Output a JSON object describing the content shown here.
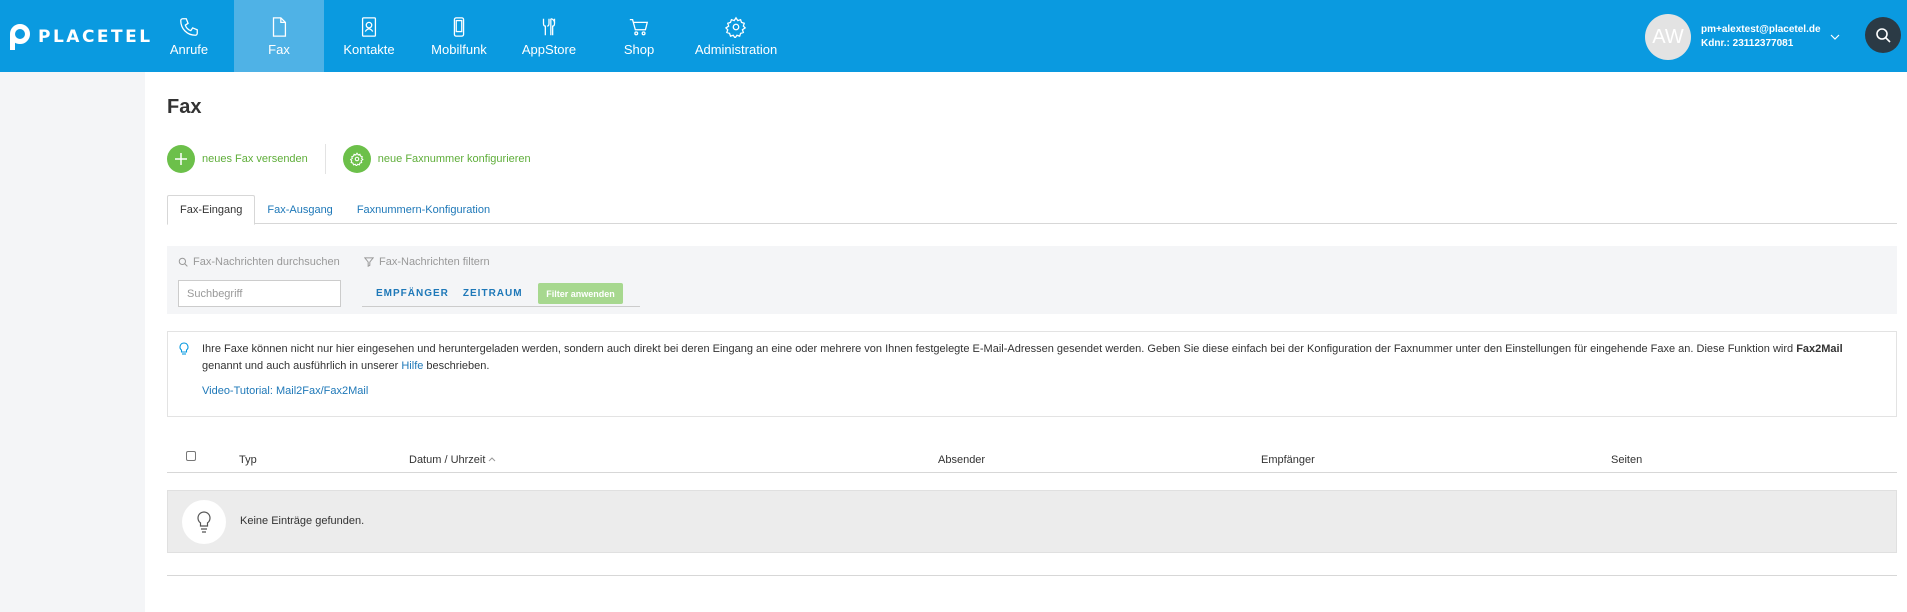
{
  "brand": {
    "logo_text": "PLACETEL"
  },
  "nav": [
    {
      "label": "Anrufe",
      "icon": "phone-icon"
    },
    {
      "label": "Fax",
      "icon": "fax-document-icon",
      "active": true
    },
    {
      "label": "Kontakte",
      "icon": "contacts-icon"
    },
    {
      "label": "Mobilfunk",
      "icon": "mobile-icon"
    },
    {
      "label": "AppStore",
      "icon": "appstore-icon"
    },
    {
      "label": "Shop",
      "icon": "cart-icon"
    },
    {
      "label": "Administration",
      "icon": "gear-icon"
    }
  ],
  "account": {
    "initials": "AW",
    "email": "pm+alextest@placetel.de",
    "customer_no": "Kdnr.: 23112377081"
  },
  "page": {
    "title": "Fax"
  },
  "actions": {
    "send_fax": "neues Fax versenden",
    "configure_number": "neue Faxnummer konfigurieren"
  },
  "tabs": [
    {
      "label": "Fax-Eingang",
      "active": true
    },
    {
      "label": "Fax-Ausgang"
    },
    {
      "label": "Faxnummern-Konfiguration"
    }
  ],
  "filter": {
    "search_label": "Fax-Nachrichten durchsuchen",
    "search_placeholder": "Suchbegriff",
    "filter_label": "Fax-Nachrichten filtern",
    "recipient": "EMPFÄNGER",
    "period": "ZEITRAUM",
    "apply": "Filter anwenden"
  },
  "info": {
    "text_1": "Ihre Faxe können nicht nur hier eingesehen und heruntergeladen werden, sondern auch direkt bei deren Eingang an eine oder mehrere von Ihnen festgelegte E-Mail-Adressen gesendet werden. Geben Sie diese einfach bei der Konfiguration der Faxnummer unter den Einstellungen für eingehende Faxe an. Diese Funktion wird ",
    "bold": "Fax2Mail",
    "text_2": " genannt und auch ausführlich in unserer ",
    "link": "Hilfe",
    "text_3": " beschrieben.",
    "video": "Video-Tutorial: Mail2Fax/Fax2Mail"
  },
  "table": {
    "columns": [
      "Typ",
      "Datum / Uhrzeit",
      "Absender",
      "Empfänger",
      "Seiten"
    ],
    "sort_indicator": "^",
    "empty": "Keine Einträge gefunden."
  },
  "colors": {
    "header": "#0a9ae0",
    "active_tab": "#4fb2e6",
    "accent_green": "#6cc04a",
    "link": "#1e78b8"
  }
}
